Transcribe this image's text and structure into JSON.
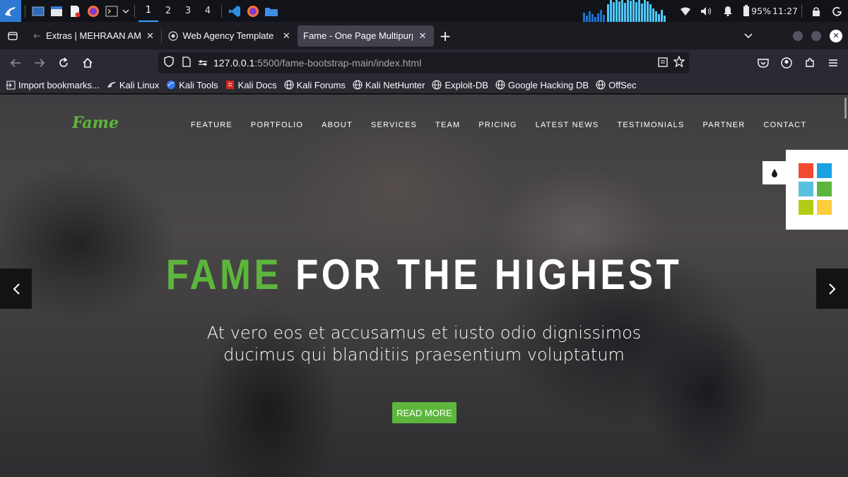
{
  "taskbar": {
    "workspaces": [
      "1",
      "2",
      "3",
      "4"
    ],
    "active_workspace": "1",
    "battery": "95%",
    "clock": "11:27"
  },
  "tabs": [
    {
      "title": "Extras | MEHRAAN AMIN",
      "active": false
    },
    {
      "title": "Web Agency Template De",
      "active": false
    },
    {
      "title": "Fame - One Page Multipurpo",
      "active": true
    }
  ],
  "address_bar": {
    "host": "127.0.0.1",
    "path": ":5500/fame-bootstrap-main/index.html"
  },
  "bookmarks": [
    {
      "label": "Import bookmarks...",
      "icon": "import-icon"
    },
    {
      "label": "Kali Linux",
      "icon": "kali-dragon-icon"
    },
    {
      "label": "Kali Tools",
      "icon": "kali-tools-icon"
    },
    {
      "label": "Kali Docs",
      "icon": "kali-docs-icon"
    },
    {
      "label": "Kali Forums",
      "icon": "globe-icon"
    },
    {
      "label": "Kali NetHunter",
      "icon": "globe-icon"
    },
    {
      "label": "Exploit-DB",
      "icon": "globe-icon"
    },
    {
      "label": "Google Hacking DB",
      "icon": "globe-icon"
    },
    {
      "label": "OffSec",
      "icon": "globe-icon"
    }
  ],
  "site": {
    "logo": "Fame",
    "menu": [
      "FEATURE",
      "PORTFOLIO",
      "ABOUT",
      "SERVICES",
      "TEAM",
      "PRICING",
      "LATEST NEWS",
      "TESTIMONIALS",
      "PARTNER",
      "CONTACT"
    ],
    "hero": {
      "title_accent": "FAME",
      "title_rest": "FOR THE HIGHEST",
      "subtitle_line1": "At vero eos et accusamus et iusto odio dignissimos",
      "subtitle_line2": "ducimus qui blanditiis praesentium voluptatum",
      "button": "READ MORE"
    },
    "color_swatches": [
      "#f44a32",
      "#1ba1e2",
      "#5bc0de",
      "#5cb63c",
      "#b4cb14",
      "#fdcd3e"
    ],
    "accent_color": "#5cb63c"
  }
}
